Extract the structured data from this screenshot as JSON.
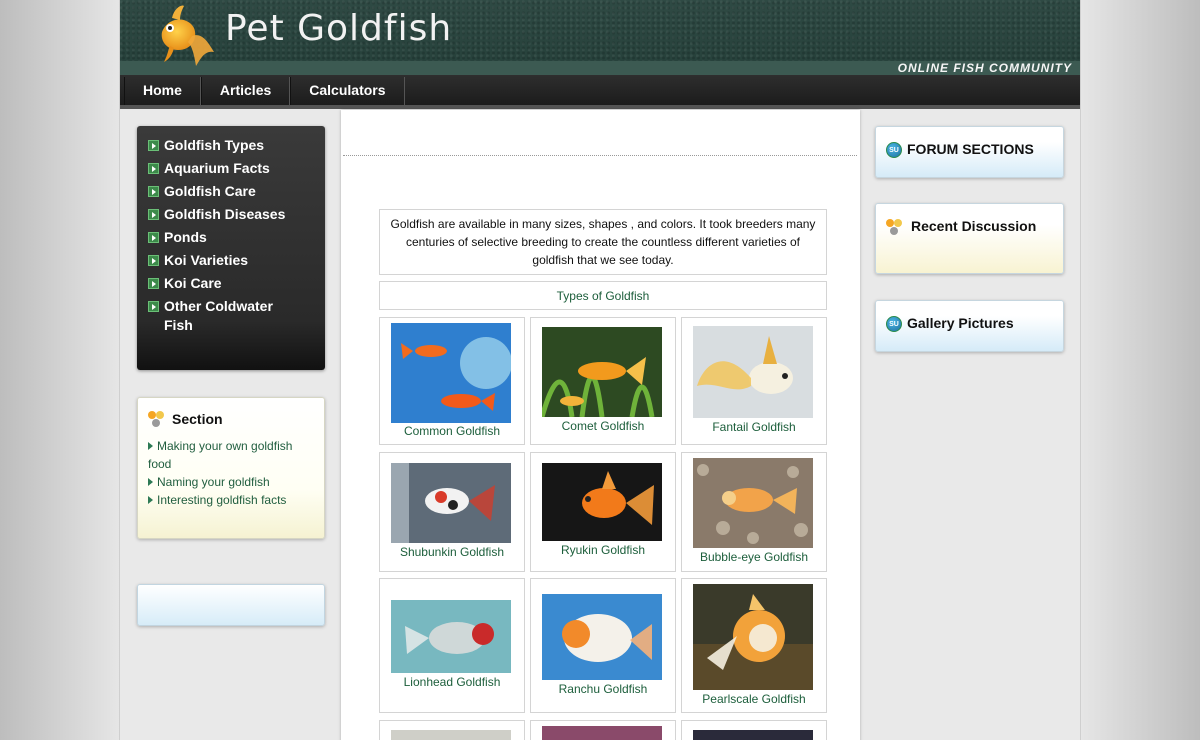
{
  "site": {
    "title": "Pet Goldfish",
    "tagline": "ONLINE FISH COMMUNITY"
  },
  "nav": [
    "Home",
    "Articles",
    "Calculators"
  ],
  "left_menu": [
    "Goldfish Types",
    "Aquarium Facts",
    "Goldfish Care",
    "Goldfish Diseases",
    "Ponds",
    "Koi Varieties",
    "Koi Care",
    "Other Coldwater Fish"
  ],
  "section_box": {
    "title": "Section",
    "links": [
      "Making your own goldfish food",
      "Naming your goldfish",
      "Interesting goldfish facts"
    ]
  },
  "main": {
    "intro": "Goldfish are available in many sizes, shapes , and colors. It took breeders many centuries of selective breeding to create the countless different varieties of goldfish that we see today.",
    "types_heading": "Types of Goldfish",
    "fish": [
      "Common Goldfish",
      "Comet Goldfish",
      "Fantail Goldfish",
      "Shubunkin Goldfish",
      "Ryukin Goldfish",
      "Bubble-eye Goldfish",
      "Lionhead Goldfish",
      "Ranchu Goldfish",
      "Pearlscale Goldfish"
    ]
  },
  "right_boxes": [
    "FORUM SECTIONS",
    "Recent Discussion",
    "Gallery Pictures"
  ],
  "colors": {
    "link_green": "#1c5e3b",
    "nav_bg": "#1c1c1c",
    "header_bg": "#2f4a44"
  }
}
